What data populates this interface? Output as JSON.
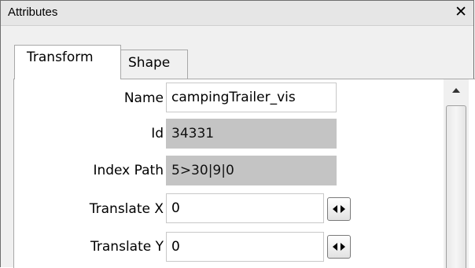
{
  "window": {
    "title": "Attributes",
    "close_glyph": "✕"
  },
  "tabs": [
    {
      "label": "Transform",
      "active": true
    },
    {
      "label": "Shape",
      "active": false
    }
  ],
  "fields": {
    "name": {
      "label": "Name",
      "value": "campingTrailer_vis",
      "editable": true
    },
    "id": {
      "label": "Id",
      "value": "34331",
      "editable": false
    },
    "index_path": {
      "label": "Index Path",
      "value": "5>30|9|0",
      "editable": false
    },
    "translate_x": {
      "label": "Translate X",
      "value": "0",
      "editable": true
    },
    "translate_y": {
      "label": "Translate Y",
      "value": "0",
      "editable": true
    }
  },
  "icons": {
    "close": "close-icon",
    "stepper": "left-right-arrows-icon",
    "scroll_up": "scroll-up-arrow-icon"
  },
  "colors": {
    "readonly_bg": "#c4c4c4",
    "panel_bg": "#f0f0f0",
    "titlebar_bg": "#e6e6e6"
  }
}
